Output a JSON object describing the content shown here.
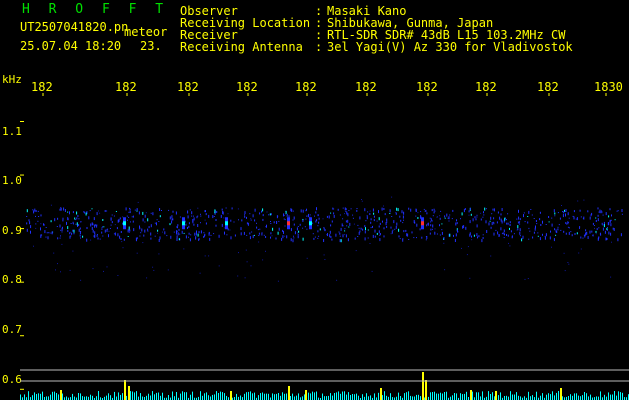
{
  "app": {
    "name": "H R O F F T",
    "filename": "UT2507041820.pn",
    "mode": "meteor",
    "datetime": "25.07.04 18:20",
    "extra": "23."
  },
  "header": {
    "rows": [
      {
        "label": "Observer",
        "sep": ":",
        "value": "Masaki Kano"
      },
      {
        "label": "Receiving Location",
        "sep": ":",
        "value": "Shibukawa, Gunma, Japan"
      },
      {
        "label": "Receiver",
        "sep": ":",
        "value": "RTL-SDR SDR# 43dB L15 103.2MHz CW"
      },
      {
        "label": "Receiving Antenna",
        "sep": ":",
        "value": "3el Yagi(V) Az 330 for Vladivostok"
      }
    ]
  },
  "colors": {
    "background": "#000000",
    "text": "#ffff00",
    "app_name": "#00e000",
    "signal_blue": "#2030ff",
    "signal_cyan": "#00ffff",
    "signal_red": "#ff3030",
    "bar_yellow": "#ffff00"
  },
  "chart_data": {
    "type": "heatmap",
    "x_unit_label": "",
    "y_unit_label": "kHz",
    "x_tick_labels": [
      "182",
      "182",
      "182",
      "182",
      "182",
      "182",
      "182",
      "182",
      "182",
      "1830"
    ],
    "y_tick_labels": [
      "1.1",
      "1.0",
      "0.9",
      "0.8",
      "0.7",
      "0.6"
    ],
    "y_ticks": [
      1.1,
      1.0,
      0.9,
      0.8,
      0.7,
      0.6
    ],
    "ylim": [
      0.58,
      1.17
    ],
    "signal_band_khz": [
      0.88,
      0.94
    ],
    "bright_events_khz": 0.91,
    "grid": true
  }
}
